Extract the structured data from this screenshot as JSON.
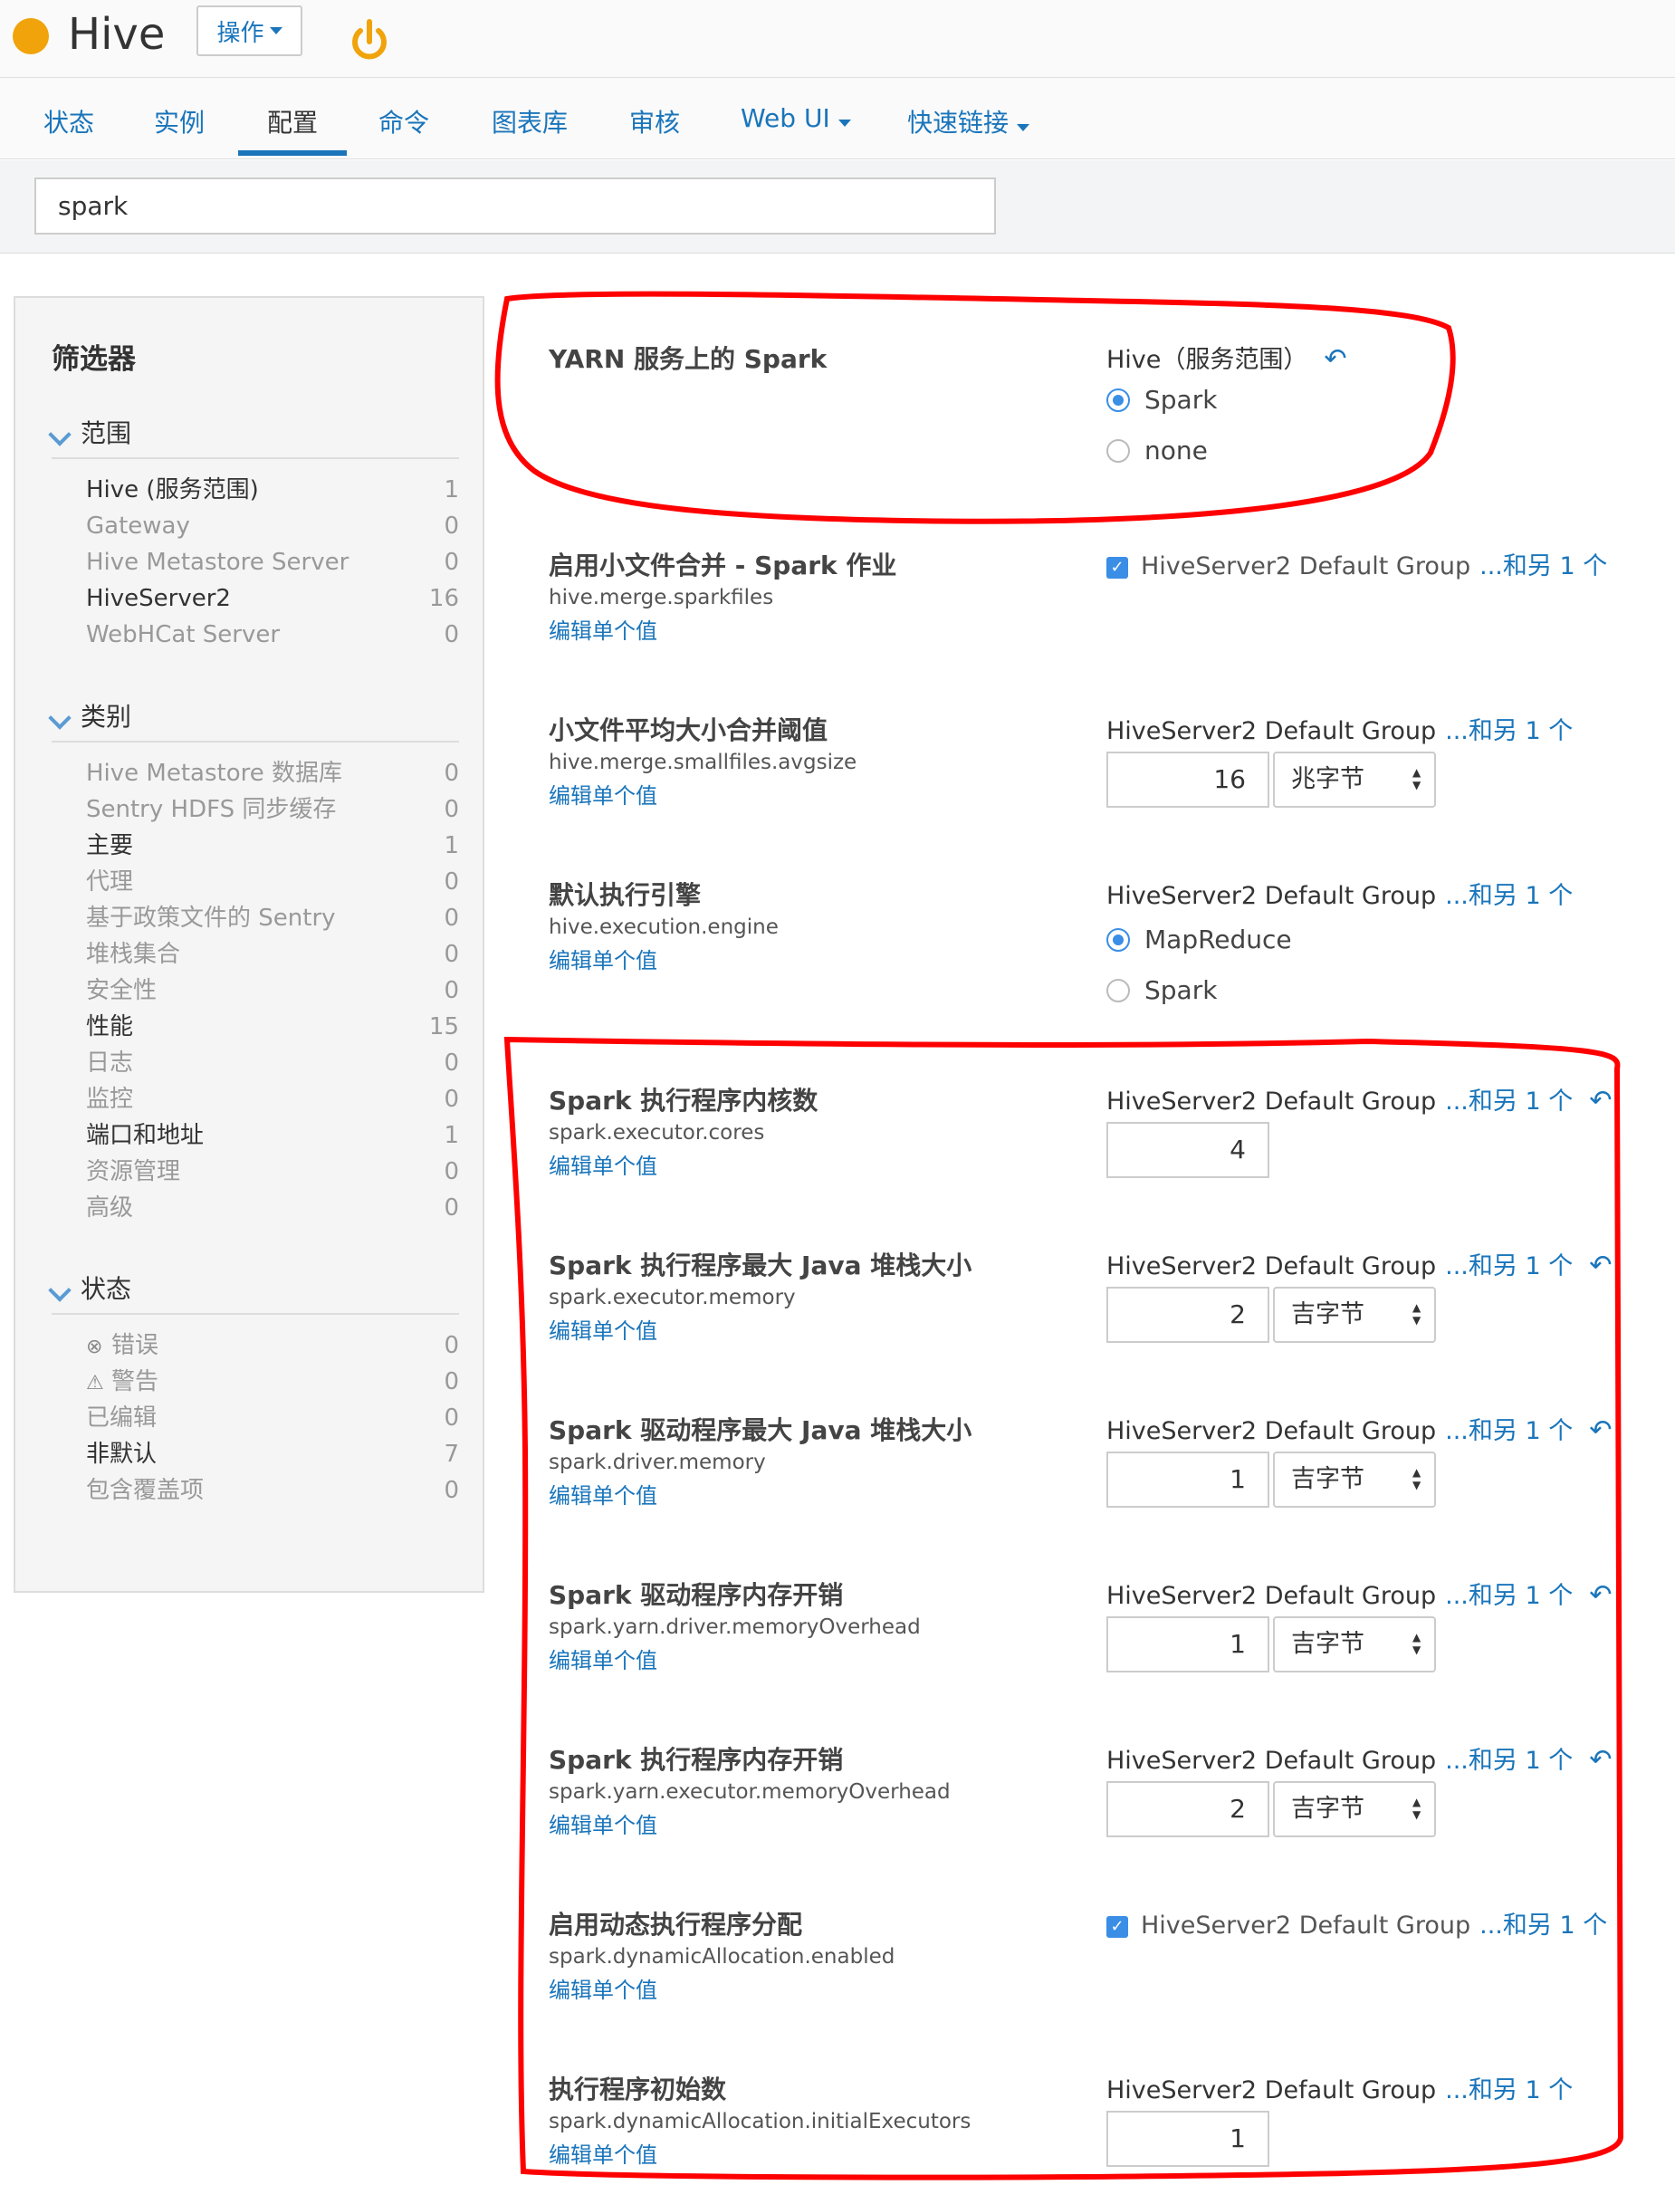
{
  "header": {
    "app_title": "Hive",
    "actions_label": "操作",
    "status_color": "#f0a30a"
  },
  "tabs": [
    {
      "label": "状态"
    },
    {
      "label": "实例"
    },
    {
      "label": "配置"
    },
    {
      "label": "命令"
    },
    {
      "label": "图表库"
    },
    {
      "label": "审核"
    },
    {
      "label": "Web UI"
    },
    {
      "label": "快速链接"
    }
  ],
  "search": {
    "value": "spark"
  },
  "sidebar": {
    "title": "筛选器",
    "scope": {
      "heading": "范围",
      "items": [
        {
          "label": "Hive (服务范围)",
          "count": "1"
        },
        {
          "label": "Gateway",
          "count": "0"
        },
        {
          "label": "Hive Metastore Server",
          "count": "0"
        },
        {
          "label": "HiveServer2",
          "count": "16"
        },
        {
          "label": "WebHCat Server",
          "count": "0"
        }
      ]
    },
    "category": {
      "heading": "类别",
      "items": [
        {
          "label": "Hive Metastore 数据库",
          "count": "0"
        },
        {
          "label": "Sentry HDFS 同步缓存",
          "count": "0"
        },
        {
          "label": "主要",
          "count": "1"
        },
        {
          "label": "代理",
          "count": "0"
        },
        {
          "label": "基于政策文件的 Sentry",
          "count": "0"
        },
        {
          "label": "堆栈集合",
          "count": "0"
        },
        {
          "label": "安全性",
          "count": "0"
        },
        {
          "label": "性能",
          "count": "15"
        },
        {
          "label": "日志",
          "count": "0"
        },
        {
          "label": "监控",
          "count": "0"
        },
        {
          "label": "端口和地址",
          "count": "1"
        },
        {
          "label": "资源管理",
          "count": "0"
        },
        {
          "label": "高级",
          "count": "0"
        }
      ]
    },
    "state": {
      "heading": "状态",
      "items": [
        {
          "label": "错误",
          "count": "0"
        },
        {
          "label": "警告",
          "count": "0"
        },
        {
          "label": "已编辑",
          "count": "0"
        },
        {
          "label": "非默认",
          "count": "7"
        },
        {
          "label": "包含覆盖项",
          "count": "0"
        }
      ]
    }
  },
  "config": {
    "edit_label": "编辑单个值",
    "group_label": "HiveServer2 Default Group",
    "more_label": "...和另 1 个",
    "rows": [
      {
        "title": "YARN 服务上的 Spark",
        "scope": "Hive（服务范围）",
        "options": [
          "Spark",
          "none"
        ]
      },
      {
        "title": "启用小文件合并 - Spark 作业",
        "key": "hive.merge.sparkfiles"
      },
      {
        "title": "小文件平均大小合并阈值",
        "key": "hive.merge.smallfiles.avgsize",
        "value": "16",
        "unit": "兆字节"
      },
      {
        "title": "默认执行引擎",
        "key": "hive.execution.engine",
        "options": [
          "MapReduce",
          "Spark"
        ]
      },
      {
        "title": "Spark 执行程序内核数",
        "key": "spark.executor.cores",
        "value": "4"
      },
      {
        "title": "Spark 执行程序最大 Java 堆栈大小",
        "key": "spark.executor.memory",
        "value": "2",
        "unit": "吉字节"
      },
      {
        "title": "Spark 驱动程序最大 Java 堆栈大小",
        "key": "spark.driver.memory",
        "value": "1",
        "unit": "吉字节"
      },
      {
        "title": "Spark 驱动程序内存开销",
        "key": "spark.yarn.driver.memoryOverhead",
        "value": "1",
        "unit": "吉字节"
      },
      {
        "title": "Spark 执行程序内存开销",
        "key": "spark.yarn.executor.memoryOverhead",
        "value": "2",
        "unit": "吉字节"
      },
      {
        "title": "启用动态执行程序分配",
        "key": "spark.dynamicAllocation.enabled"
      },
      {
        "title": "执行程序初始数",
        "key": "spark.dynamicAllocation.initialExecutors",
        "value": "1"
      }
    ]
  }
}
